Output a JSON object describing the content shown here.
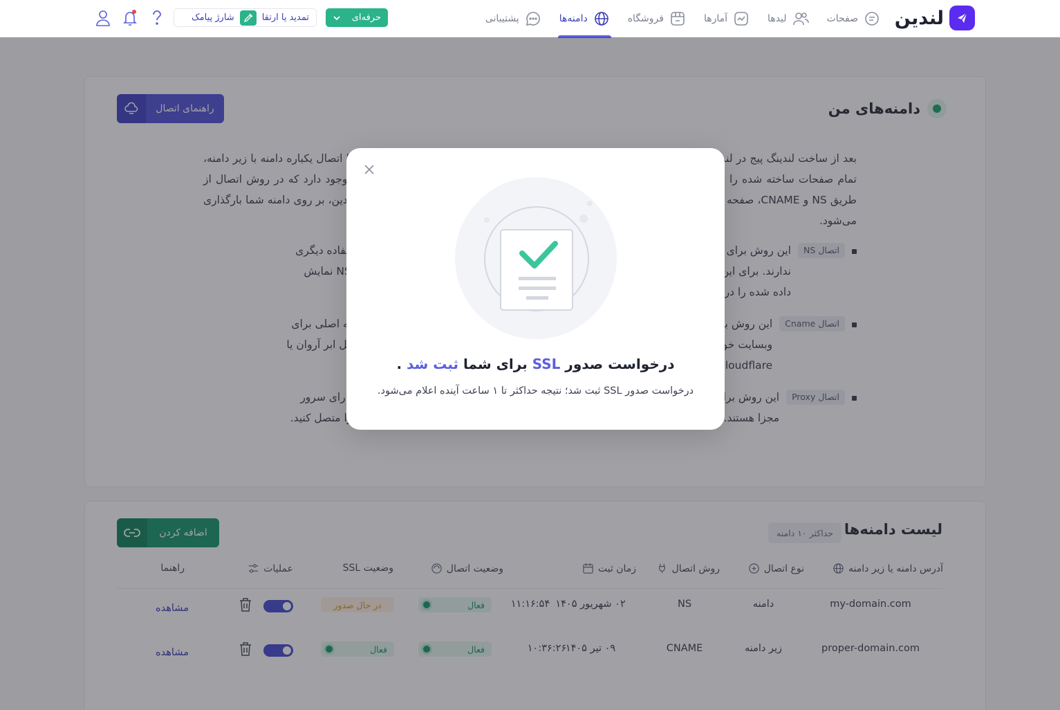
{
  "brand": {
    "name": "لندین",
    "accent": "#5b2cf0"
  },
  "nav": {
    "items": [
      {
        "label": "صفحات",
        "icon": "pages-icon"
      },
      {
        "label": "لیدها",
        "icon": "users-icon"
      },
      {
        "label": "آمارها",
        "icon": "chart-icon"
      },
      {
        "label": "فروشگاه",
        "icon": "store-icon"
      },
      {
        "label": "دامنه‌ها",
        "icon": "globe-icon",
        "active": true
      },
      {
        "label": "پشتیبانی",
        "icon": "chat-icon"
      }
    ],
    "plan_label": "حرفه‌ای",
    "renew_label": "تمدید یا ارتقا",
    "sms_label": "شارژ پیامک"
  },
  "domains_section": {
    "title": "دامنه‌های من",
    "guide_button": "راهنمای اتصال",
    "intro": "بعد از ساخت لندینگ پیج در لندین، می‌توانید آن را به دامنه یا زیر دامنه‌ی اختصاصی خود منتشر کنید. در این روش با اتصال یکباره دامنه با زیر دامنه، تمام صفحات ساخته شده را می‌توانید روی آن منتشر کنید. برای این منظور در بخش تنظیمات، سه روش اتصال وجود دارد که در روش اتصال از طریق NS و CNAME، صفحه از سرورهای لندین بارگذاری می‌شود و در روش اتصال Proxy، صفحه از سرورهای لندین، بر روی دامنه شما بارگذاری می‌شود.",
    "methods": [
      {
        "chip": "اتصال NS",
        "text": "این روش برای افرادی مناسب است که دامنه جدیدی برای لندینگ خود تهیه می‌کنند. و از آن دامنه استفاده دیگری ندارند. برای این روش کافیست دامنه خود را در بخش مدیریت دامنه‌ها اضافه کنید. سپس رکوردهای NS نمایش داده شده را در پنل ثبت دامنه خود وارد کنید."
      },
      {
        "chip": "اتصال Cname",
        "text": "این روش برای افرادی مناسب است که می‌خواهند زیر دامنه‌ای را به لندین متصل کنند. مثلا صفحه اصلی برای وبسایت خود دارند و می‌خواهند لندینگ روی زیر دامنه باشد. کافیست در پنل‌های مدیریت DNS مثل ابر آروان یا Cloudflare ، یک رکورد Cname جدید با تنظیمات نمایش داده شده بسازند."
      },
      {
        "chip": "اتصال Proxy",
        "text": "این روش برای افرادی مناسب است که می‌خواهند لندینگ را به صورت مسیر داخلی وصل کنند و دارای سرور مجزا هستند. همچنین اگر هاست دارید میتوانید مطابق با روش اتصال با اسکریپت لندینگ پیج خود را متصل کنید."
      }
    ]
  },
  "domain_list": {
    "title": "لیست دامنه‌ها",
    "limit": "حداکثر ۱۰ دامنه",
    "add_button": "اضافه کردن",
    "columns": {
      "address": "آدرس دامنه یا زیر دامنه",
      "type": "نوع اتصال",
      "method": "روش اتصال",
      "created": "زمان ثبت",
      "status": "وضعیت اتصال",
      "ssl": "وضعیت SSL",
      "actions": "عملیات",
      "guide": "راهنما"
    },
    "rows": [
      {
        "address": "my-domain.com",
        "type": "دامنه",
        "method": "NS",
        "date": "۰۲ شهریور ۱۴۰۵",
        "time": "۱۱:۱۶:۵۴",
        "status": "فعال",
        "ssl": "در حال صدور",
        "ssl_ok": false,
        "view": "مشاهده"
      },
      {
        "address": "proper-domain.com",
        "type": "زیر دامنه",
        "method": "CNAME",
        "date": "۰۹ تیر ۱۴۰۵",
        "time": "۱۰:۳۶:۲۶",
        "status": "فعال",
        "ssl": "فعال",
        "ssl_ok": true,
        "view": "مشاهده"
      }
    ]
  },
  "modal": {
    "title_part1": "درخواست صدور ",
    "title_ssl": "SSL",
    "title_part2": " برای شما ",
    "title_done": "ثبت شد",
    "title_end": " .",
    "subtitle": "درخواست صدور SSL ثبت شد؛ نتیجه حداکثر تا ۱ ساعت آینده اعلام می‌شود."
  }
}
